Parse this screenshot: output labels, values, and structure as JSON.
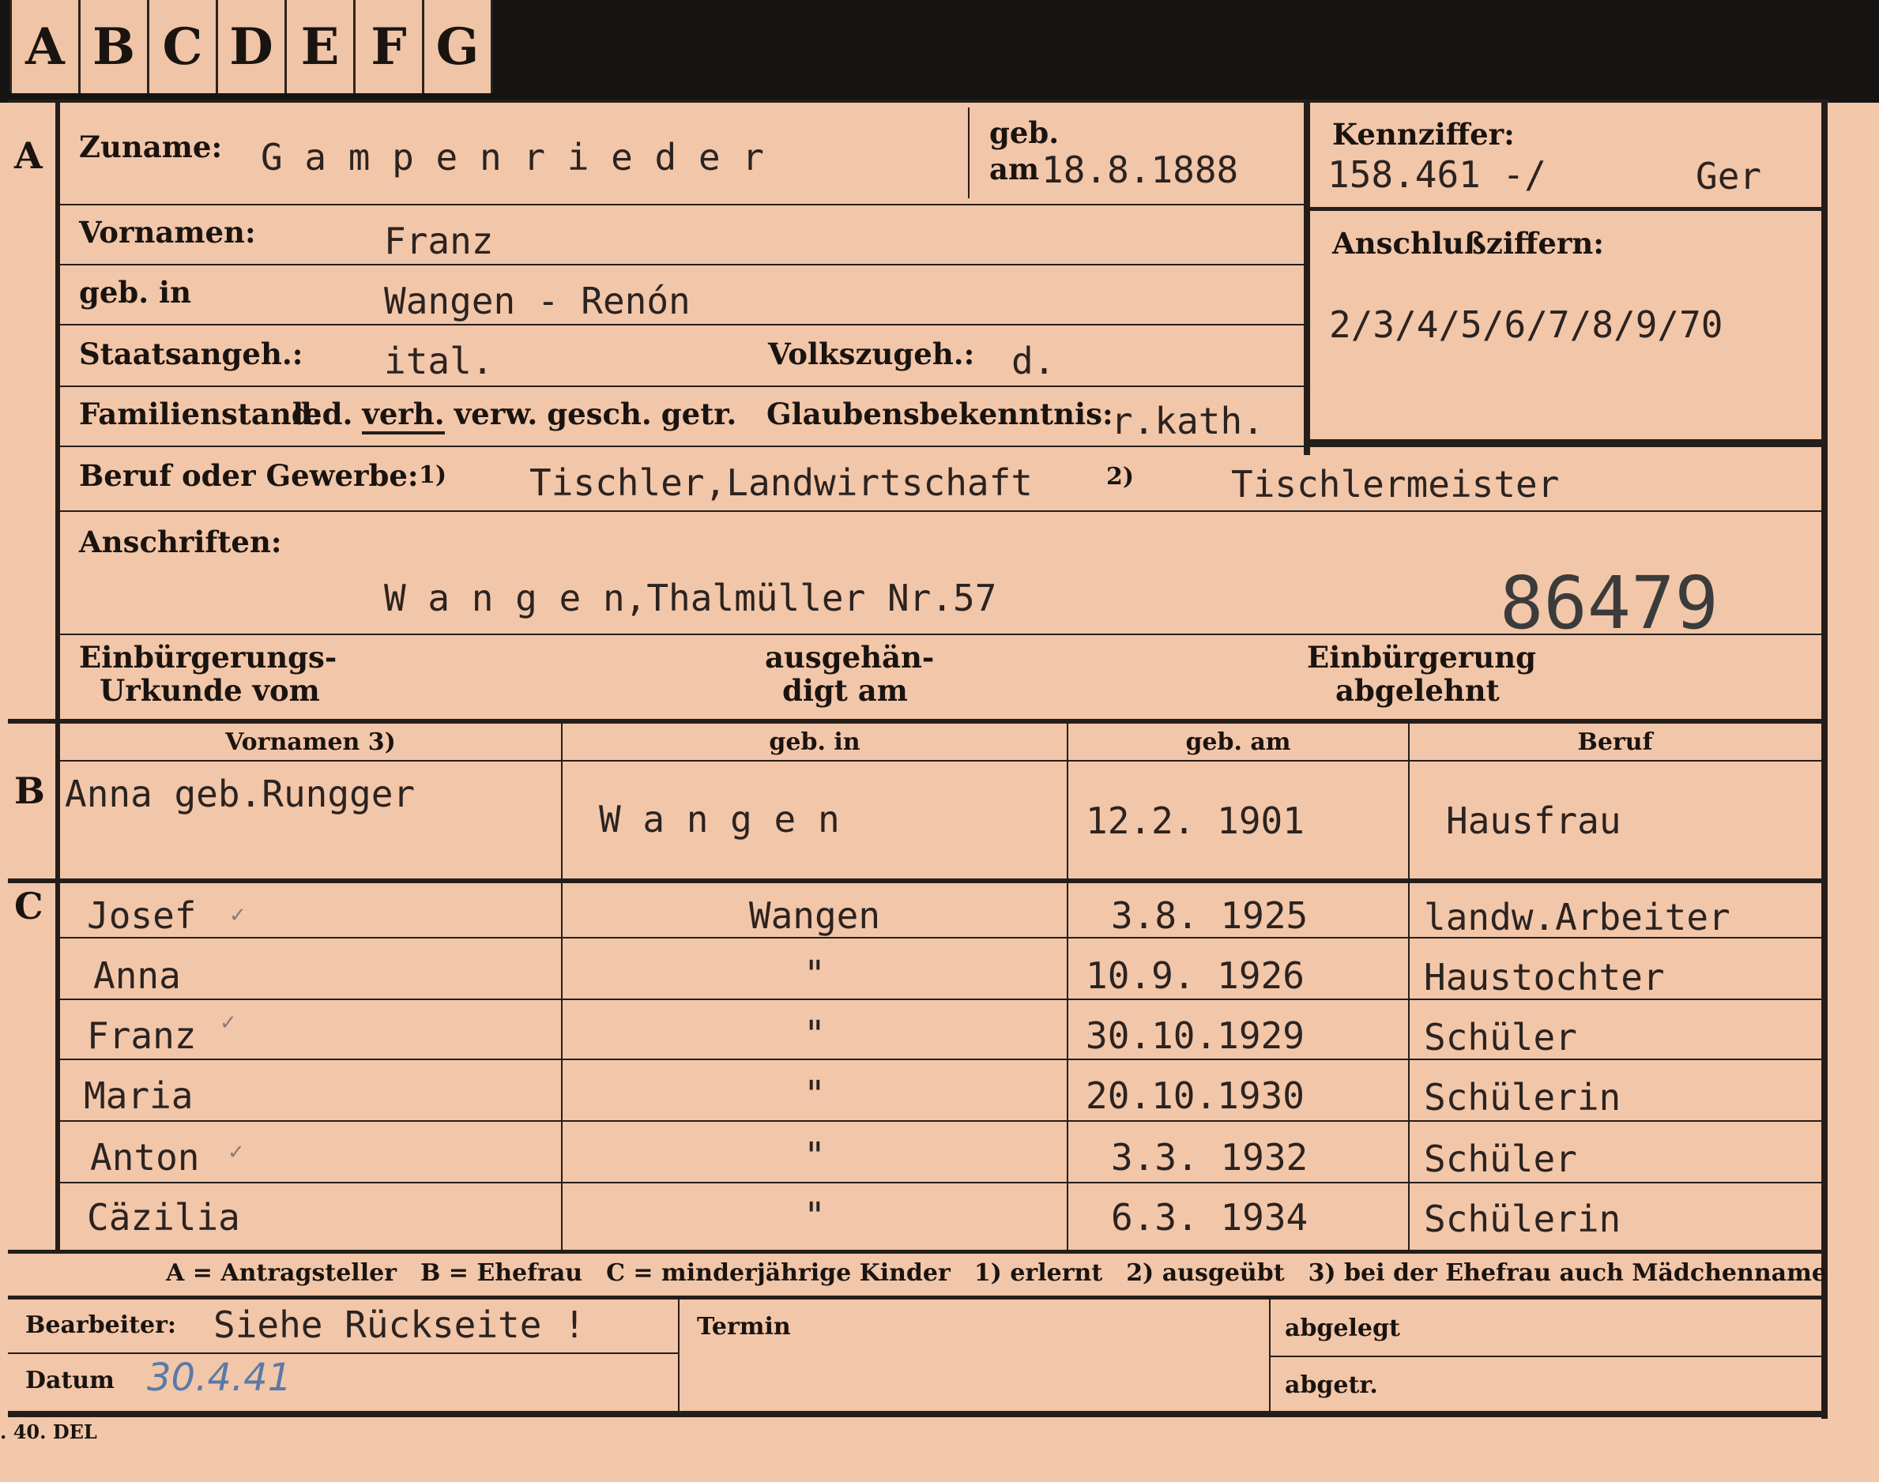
{
  "tabs": [
    "A",
    "B",
    "C",
    "D",
    "E",
    "F",
    "G"
  ],
  "sections": {
    "a": "A",
    "b": "B",
    "c": "C"
  },
  "header": {
    "zuname_label": "Zuname:",
    "zuname_value": "G a m p e n r i e d e r",
    "geb_label": "geb.",
    "geb_am_label": "am",
    "geb_am_value": "18.8.1888",
    "kennziffer_label": "Kennziffer:",
    "kennziffer_value": "158.461 -/",
    "kennziffer_suffix": "Ger",
    "anschluss_label": "Anschlußziffern:",
    "anschluss_value": "2/3/4/5/6/7/8/9/70",
    "vornamen_label": "Vornamen:",
    "vornamen_value": "Franz",
    "gebin_label": "geb. in",
    "gebin_value": "Wangen - Renón",
    "staat_label": "Staatsangeh.:",
    "staat_value": "ital.",
    "volk_label": "Volkszugeh.:",
    "volk_value": "d.",
    "familien_label": "Familienstand:",
    "familien_options": [
      "led.",
      "verh.",
      "verw.",
      "gesch.",
      "getr."
    ],
    "familien_selected": "verh.",
    "glauben_label": "Glaubensbekenntnis:",
    "glauben_value": "r.kath.",
    "beruf_label": "Beruf oder Gewerbe:",
    "beruf_note1": "1)",
    "beruf_value1": "Tischler,Landwirtschaft",
    "beruf_note2": "2)",
    "beruf_value2": "Tischlermeister",
    "anschriften_label": "Anschriften:",
    "anschriften_value": "W a n g e n,Thalmüller Nr.57",
    "stamp_number": "86479",
    "einb_urkunde_1": "Einbürgerungs-",
    "einb_urkunde_2": "Urkunde vom",
    "ausgeh_1": "ausgehän-",
    "ausgeh_2": "digt am",
    "einb_abg_1": "Einbürgerung",
    "einb_abg_2": "abgelehnt"
  },
  "table": {
    "columns": [
      "Vornamen 3)",
      "geb. in",
      "geb. am",
      "Beruf"
    ],
    "spouse": {
      "name": "Anna geb.Rungger",
      "place": "W a n g e n",
      "date": "12.2. 1901",
      "job": "Hausfrau"
    },
    "children": [
      {
        "name": "Josef",
        "tick": "✓",
        "place": "Wangen",
        "date": "3.8. 1925",
        "job": "landw.Arbeiter"
      },
      {
        "name": "Anna",
        "tick": "",
        "place": "\"",
        "date": "10.9. 1926",
        "job": "Haustochter"
      },
      {
        "name": "Franz",
        "tick": "✓",
        "place": "\"",
        "date": "30.10.1929",
        "job": "Schüler"
      },
      {
        "name": "Maria",
        "tick": "",
        "place": "\"",
        "date": "20.10.1930",
        "job": "Schülerin"
      },
      {
        "name": "Anton",
        "tick": "✓",
        "place": "\"",
        "date": "3.3. 1932",
        "job": "Schüler"
      },
      {
        "name": "Cäzilia",
        "tick": "",
        "place": "\"",
        "date": "6.3. 1934",
        "job": "Schülerin"
      }
    ]
  },
  "legend": {
    "a": "A = Antragsteller",
    "b": "B = Ehefrau",
    "c": "C = minderjährige Kinder",
    "n1": "1) erlernt",
    "n2": "2) ausgeübt",
    "n3": "3) bei der Ehefrau auch Mädchenname"
  },
  "footer": {
    "bearbeiter_label": "Bearbeiter:",
    "bearbeiter_value": "Siehe Rückseite !",
    "datum_label": "Datum",
    "datum_value": "30.4.41",
    "termin_label": "Termin",
    "abgelegt_label": "abgelegt",
    "abgetr_label": "abgetr.",
    "print_code": ". 40. DEL"
  },
  "colors": {
    "card": "#f2c6a9",
    "ink": "#241e1a",
    "strip": "#161412",
    "pencil": "#5a7aa8"
  }
}
